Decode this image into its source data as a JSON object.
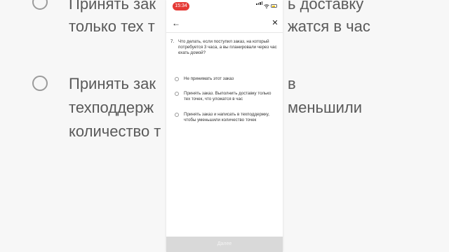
{
  "status_bar": {
    "time": "15:34"
  },
  "question": {
    "number": "7.",
    "text": "Что делать, если поступил заказ, на который потребуется 3 часа, а вы планировали через час ехать домой?"
  },
  "options": [
    {
      "label": "Не принимать этот заказ",
      "selected": false
    },
    {
      "label": "Принять заказ. Выполнить доставку только тех точек, что уложатся в час",
      "selected": false
    },
    {
      "label": "Принять заказ и написать в техподдержку, чтобы уменьшили количество точек",
      "selected": false
    }
  ],
  "submit_label": "Далее",
  "background": {
    "line1": "Принять зак",
    "line1b": "ь доставку",
    "line2": "только тех т",
    "line2b": "жатся в час",
    "line3": "Принять зак",
    "line3b": "в",
    "line4": "техподдерж",
    "line4b": "меньшили",
    "line5": "количество т"
  },
  "colors": {
    "time_badge": "#e53935",
    "submit_bg": "#d9d9d9"
  }
}
